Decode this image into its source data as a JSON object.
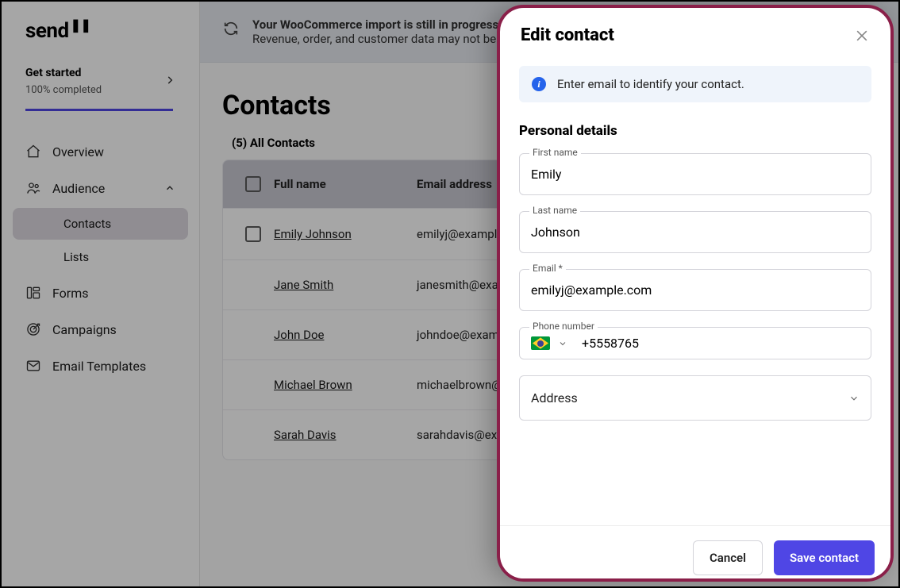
{
  "logo": "send",
  "get_started": {
    "title": "Get started",
    "subtitle": "100% completed"
  },
  "nav": {
    "overview": "Overview",
    "audience": "Audience",
    "forms": "Forms",
    "campaigns": "Campaigns",
    "email_templates": "Email Templates"
  },
  "subnav": {
    "contacts": "Contacts",
    "lists": "Lists"
  },
  "banner": {
    "title": "Your WooCommerce import is still in progress.",
    "subtitle": "Revenue, order, and customer data may not be fully"
  },
  "page": {
    "title": "Contacts",
    "tab_label": "(5) All Contacts"
  },
  "table": {
    "headers": {
      "name": "Full name",
      "email": "Email address"
    },
    "rows": [
      {
        "name": "Emily Johnson",
        "email": "emilyj@example.com"
      },
      {
        "name": "Jane Smith",
        "email": "janesmith@example.com"
      },
      {
        "name": "John Doe",
        "email": "johndoe@example.com"
      },
      {
        "name": "Michael Brown",
        "email": "michaelbrown@example..."
      },
      {
        "name": "Sarah Davis",
        "email": "sarahdavis@example.com"
      }
    ]
  },
  "drawer": {
    "title": "Edit contact",
    "info": "Enter email to identify your contact.",
    "section": "Personal details",
    "labels": {
      "first": "First name",
      "last": "Last name",
      "email": "Email *",
      "phone": "Phone number",
      "address": "Address"
    },
    "values": {
      "first": "Emily",
      "last": "Johnson",
      "email": "emilyj@example.com",
      "phone": "+5558765"
    },
    "buttons": {
      "cancel": "Cancel",
      "save": "Save contact"
    }
  }
}
